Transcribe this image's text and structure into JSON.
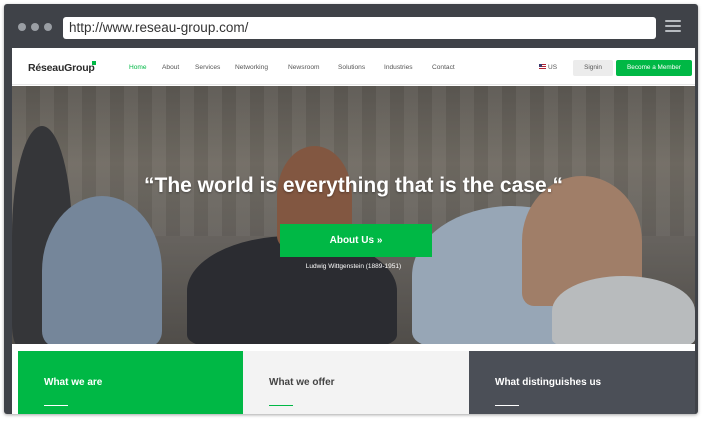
{
  "browser": {
    "url": "http://www.reseau-group.com/"
  },
  "nav": {
    "logo": "RéseauGroup",
    "items": [
      "Home",
      "About",
      "Services",
      "Networking",
      "Newsroom",
      "Solutions",
      "Industries",
      "Contact"
    ],
    "lang": "US",
    "signin": "Signin",
    "member": "Become a Member"
  },
  "hero": {
    "quote": "“The world is everything that is the case.“",
    "button": "About Us »",
    "author": "Ludwig Wittgenstein (1889-1951)"
  },
  "cards": [
    {
      "title": "What we are"
    },
    {
      "title": "What we offer"
    },
    {
      "title": "What distinguishes us"
    }
  ],
  "colors": {
    "accent": "#00b845",
    "frame": "#3f4248",
    "card_dark": "#4b4f57"
  }
}
